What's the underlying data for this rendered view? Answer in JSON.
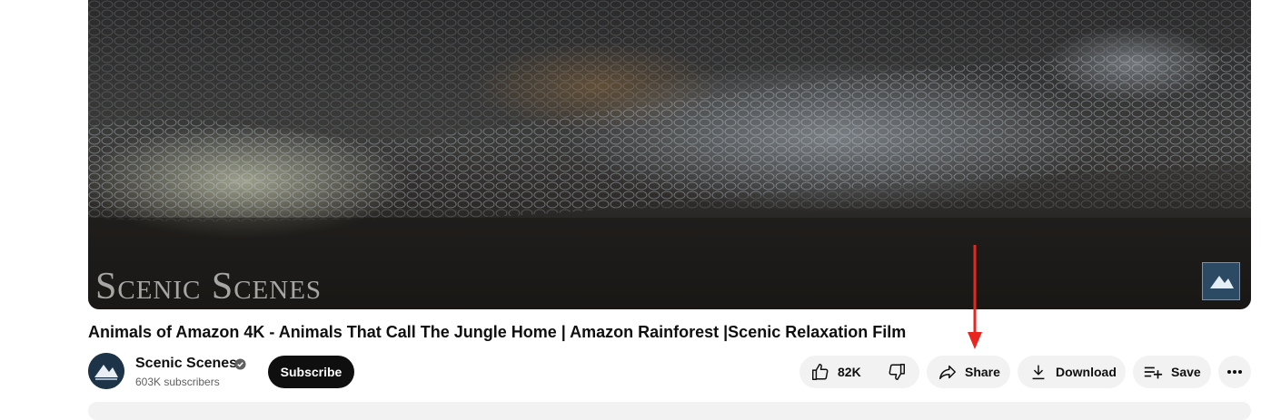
{
  "video": {
    "watermark": "Scenic Scenes",
    "title": "Animals of Amazon 4K - Animals That Call The Jungle Home | Amazon Rainforest |Scenic Relaxation Film"
  },
  "channel": {
    "name": "Scenic Scenes",
    "subscribers": "603K subscribers",
    "subscribe_label": "Subscribe"
  },
  "actions": {
    "like_count": "82K",
    "share_label": "Share",
    "download_label": "Download",
    "save_label": "Save"
  },
  "colors": {
    "annotation_arrow": "#e8261f",
    "subscribe_bg": "#0f0f0f",
    "pill_bg": "#f2f2f2"
  },
  "icons": [
    "verified-icon",
    "like-icon",
    "dislike-icon",
    "share-icon",
    "download-icon",
    "save-playlist-icon",
    "more-icon"
  ]
}
